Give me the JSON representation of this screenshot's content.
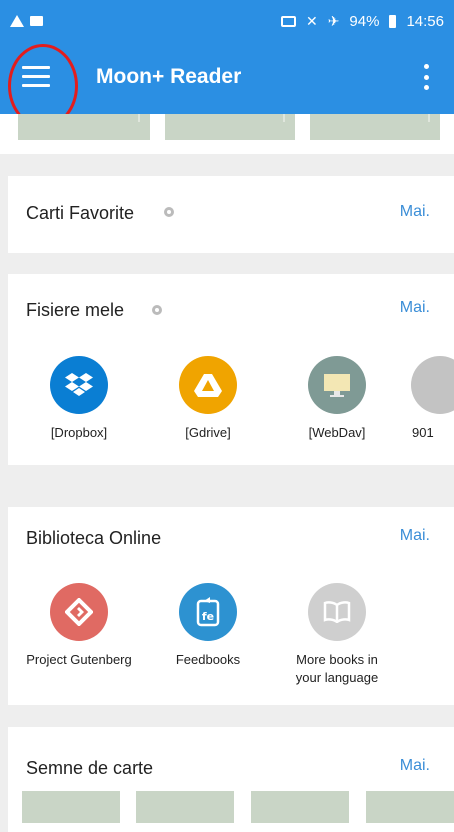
{
  "status_bar": {
    "battery": "94%",
    "time": "14:56"
  },
  "toolbar": {
    "title": "Moon+ Reader"
  },
  "sections": {
    "favorites": {
      "title": "Carti Favorite",
      "more": "Mai."
    },
    "my_files": {
      "title": "Fisiere mele",
      "more": "Mai.",
      "items": [
        {
          "label": "[Dropbox]",
          "icon": "dropbox-icon",
          "color": "#0a7ed3"
        },
        {
          "label": "[Gdrive]",
          "icon": "gdrive-icon",
          "color": "#f0a400"
        },
        {
          "label": "[WebDav]",
          "icon": "webdav-icon",
          "color": "#7f9a95"
        },
        {
          "label": "901",
          "icon": "storage-icon",
          "color": "#c3c3c3"
        }
      ]
    },
    "online_library": {
      "title": "Biblioteca Online",
      "more": "Mai.",
      "items": [
        {
          "label": "Project Gutenberg",
          "icon": "gutenberg-icon",
          "color": "#e06a63"
        },
        {
          "label": "Feedbooks",
          "icon": "feedbooks-icon",
          "color": "#2d92d1"
        },
        {
          "label": "More books in your language",
          "icon": "book-icon",
          "color": "#cfcfcf"
        }
      ]
    },
    "bookmarks": {
      "title": "Semne de carte",
      "more": "Mai."
    }
  }
}
